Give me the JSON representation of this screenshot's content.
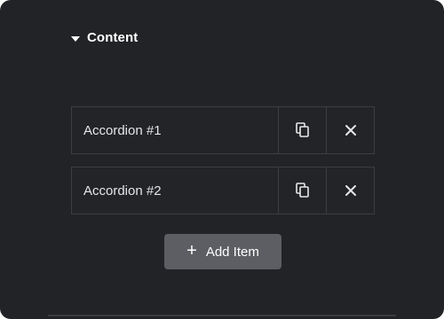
{
  "section": {
    "title": "Content"
  },
  "repeater_items": [
    {
      "label": "Accordion #1"
    },
    {
      "label": "Accordion #2"
    }
  ],
  "actions": {
    "add_item_label": "Add Item",
    "add_item_symbol": "+"
  },
  "icons": {
    "caret": "caret-down-icon",
    "duplicate": "duplicate-icon",
    "remove": "close-icon"
  },
  "colors": {
    "panel_background": "#222326",
    "border": "#3d3e42",
    "button_background": "#5c5e63",
    "text": "#ffffff"
  }
}
